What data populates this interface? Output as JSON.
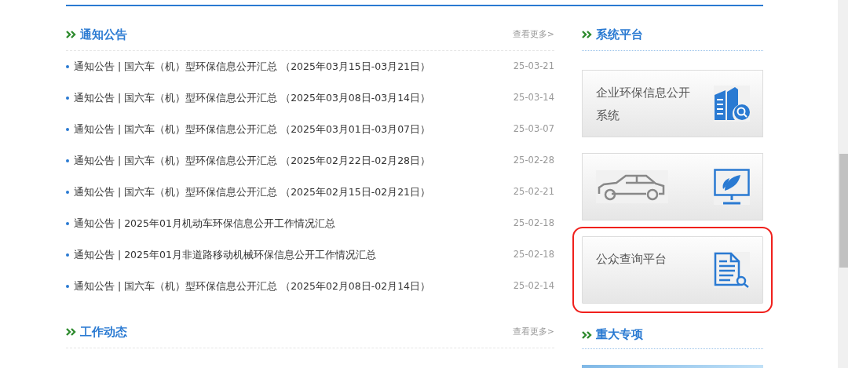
{
  "notices": {
    "title": "通知公告",
    "more": "查看更多>",
    "items": [
      {
        "text": "通知公告 | 国六车（机）型环保信息公开汇总 （2025年03月15日-03月21日）",
        "date": "25-03-21"
      },
      {
        "text": "通知公告 | 国六车（机）型环保信息公开汇总 （2025年03月08日-03月14日）",
        "date": "25-03-14"
      },
      {
        "text": "通知公告 | 国六车（机）型环保信息公开汇总 （2025年03月01日-03月07日）",
        "date": "25-03-07"
      },
      {
        "text": "通知公告 | 国六车（机）型环保信息公开汇总 （2025年02月22日-02月28日）",
        "date": "25-02-28"
      },
      {
        "text": "通知公告 | 国六车（机）型环保信息公开汇总 （2025年02月15日-02月21日）",
        "date": "25-02-21"
      },
      {
        "text": "通知公告 | 2025年01月机动车环保信息公开工作情况汇总",
        "date": "25-02-18"
      },
      {
        "text": "通知公告 | 2025年01月非道路移动机械环保信息公开工作情况汇总",
        "date": "25-02-18"
      },
      {
        "text": "通知公告 | 国六车（机）型环保信息公开汇总 （2025年02月08日-02月14日）",
        "date": "25-02-14"
      }
    ]
  },
  "work_news": {
    "title": "工作动态",
    "more": "查看更多>"
  },
  "platforms": {
    "title": "系统平台",
    "cards": [
      {
        "kind": "building",
        "label": "企业环保信息公开系统",
        "highlighted": false
      },
      {
        "kind": "car",
        "highlighted": false
      },
      {
        "kind": "document",
        "label": "公众查询平台",
        "highlighted": true
      }
    ]
  },
  "major_projects": {
    "title": "重大专项"
  }
}
